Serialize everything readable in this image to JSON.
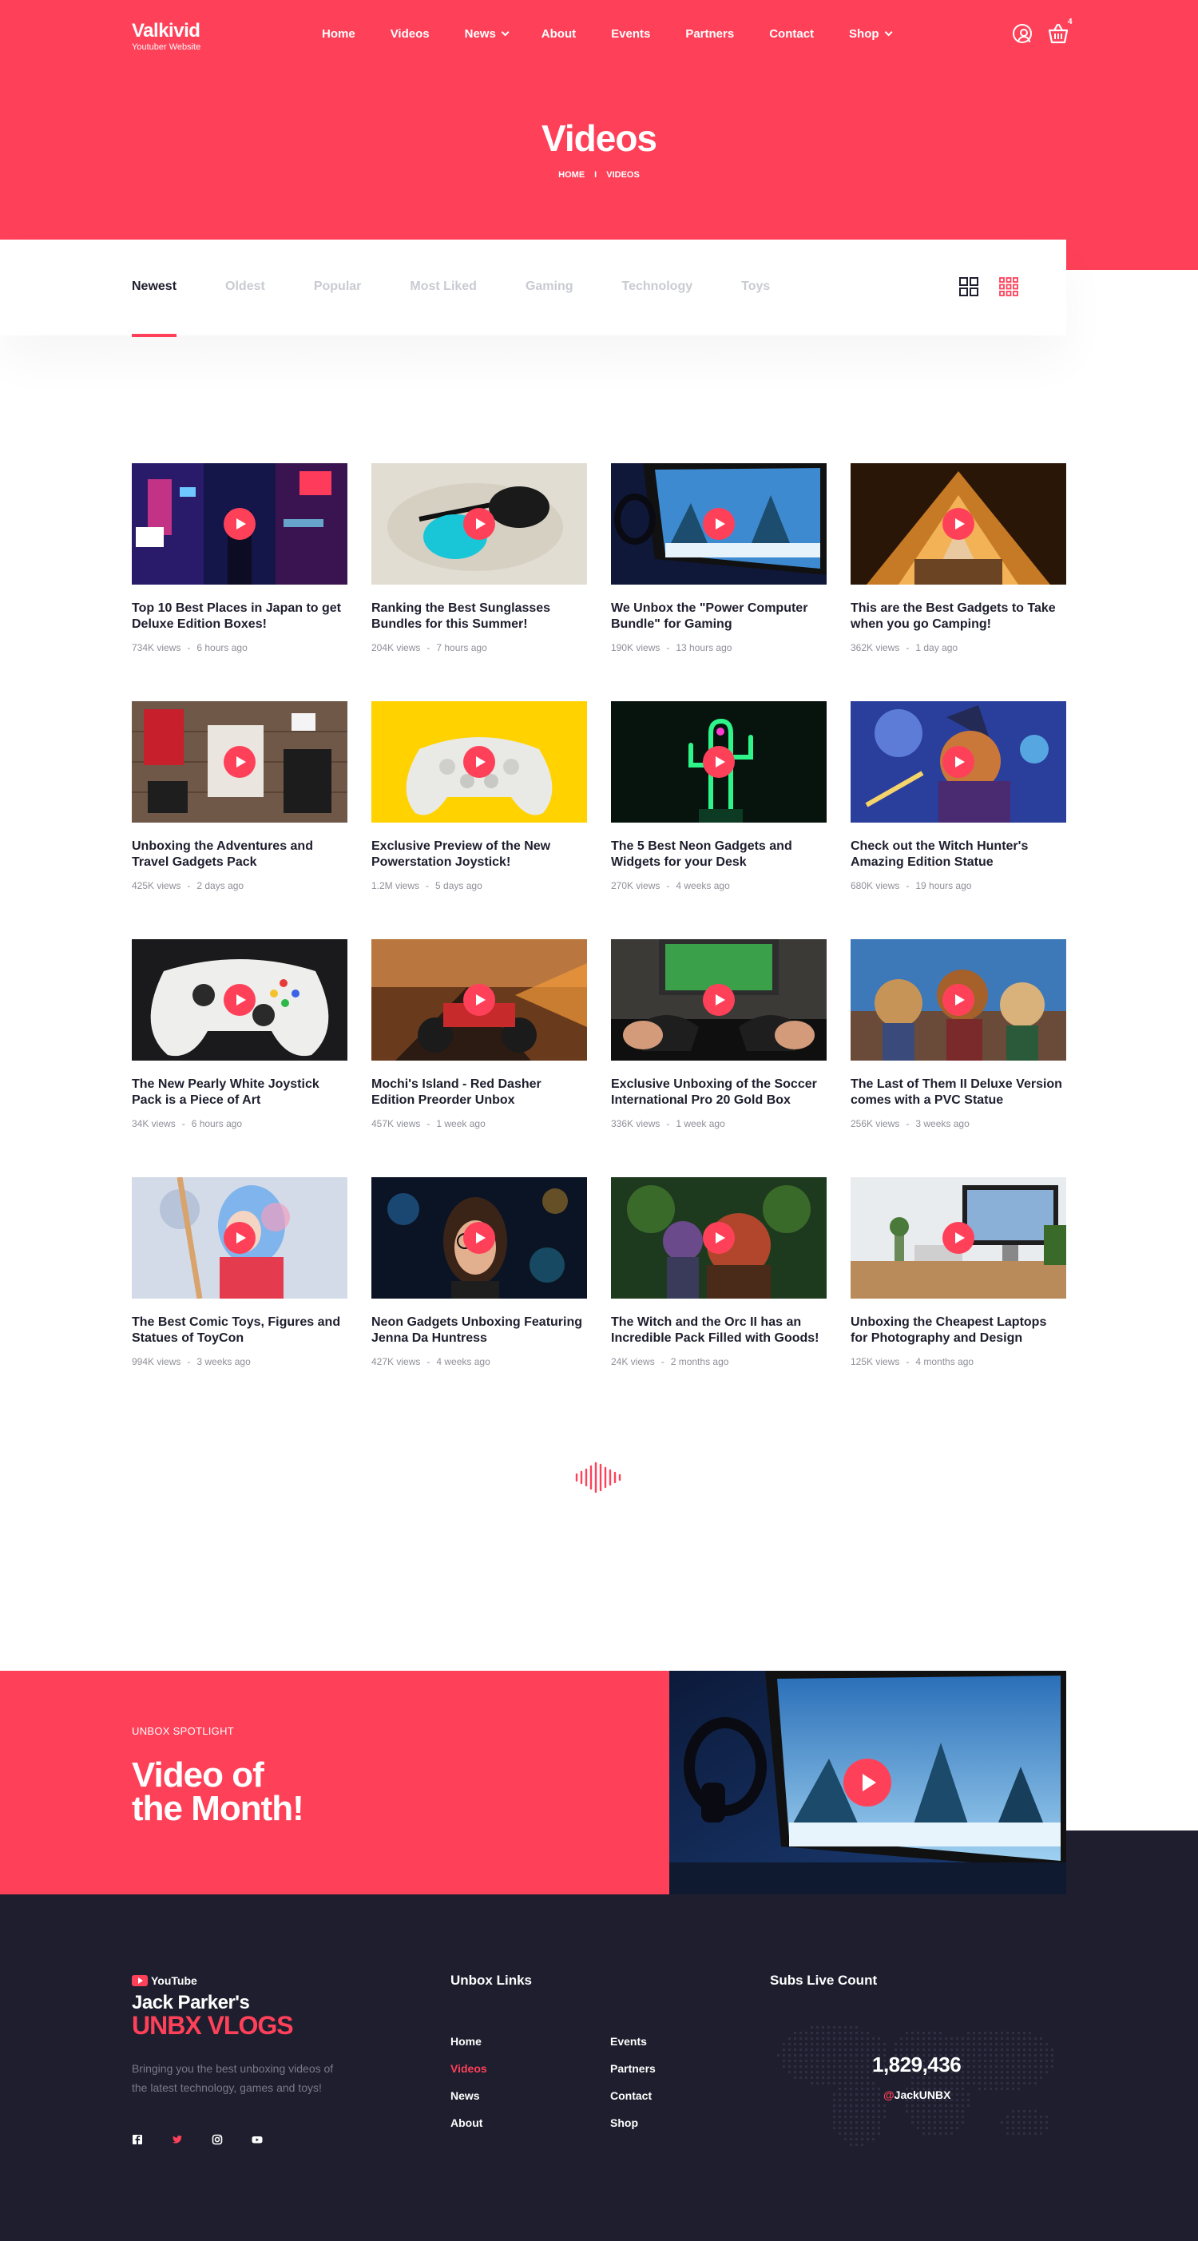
{
  "header": {
    "logo": "Valkivid",
    "tagline": "Youtuber Website",
    "nav": [
      {
        "label": "Home",
        "dropdown": false
      },
      {
        "label": "Videos",
        "dropdown": false
      },
      {
        "label": "News",
        "dropdown": true
      },
      {
        "label": "About",
        "dropdown": false
      },
      {
        "label": "Events",
        "dropdown": false
      },
      {
        "label": "Partners",
        "dropdown": false
      },
      {
        "label": "Contact",
        "dropdown": false
      },
      {
        "label": "Shop",
        "dropdown": true
      }
    ],
    "cart_count": "4",
    "icons": [
      "user-icon",
      "cart-icon"
    ]
  },
  "hero": {
    "title": "Videos",
    "breadcrumb": [
      "HOME",
      "VIDEOS"
    ]
  },
  "filters": {
    "tabs": [
      "Newest",
      "Oldest",
      "Popular",
      "Most Liked",
      "Gaming",
      "Technology",
      "Toys"
    ],
    "active": "Newest",
    "views": [
      "grid-view-icon",
      "list-view-icon"
    ]
  },
  "videos": [
    {
      "title": "Top 10 Best Places in Japan to get Deluxe Edition Boxes!",
      "views": "734K views",
      "time": "6 hours ago"
    },
    {
      "title": "Ranking the Best Sunglasses Bundles for this Summer!",
      "views": "204K views",
      "time": "7 hours ago"
    },
    {
      "title": "We Unbox the \"Power Computer Bundle\" for Gaming",
      "views": "190K views",
      "time": "13 hours ago"
    },
    {
      "title": "This are the Best Gadgets to Take when you go Camping!",
      "views": "362K views",
      "time": "1 day ago"
    },
    {
      "title": "Unboxing the Adventures and Travel Gadgets Pack",
      "views": "425K views",
      "time": "2 days ago"
    },
    {
      "title": "Exclusive Preview of the New Powerstation Joystick!",
      "views": "1.2M views",
      "time": "5 days ago"
    },
    {
      "title": "The 5 Best Neon Gadgets and Widgets for your Desk",
      "views": "270K views",
      "time": "4 weeks ago"
    },
    {
      "title": "Check out the Witch Hunter's Amazing Edition Statue",
      "views": "680K views",
      "time": "19 hours ago"
    },
    {
      "title": "The New Pearly White Joystick Pack is a Piece of Art",
      "views": "34K views",
      "time": "6 hours ago"
    },
    {
      "title": "Mochi's Island - Red Dasher Edition Preorder Unbox",
      "views": "457K views",
      "time": "1 week ago"
    },
    {
      "title": "Exclusive Unboxing of the Soccer International Pro 20 Gold Box",
      "views": "336K views",
      "time": "1 week ago"
    },
    {
      "title": "The Last of Them II Deluxe Version comes with a PVC Statue",
      "views": "256K views",
      "time": "3 weeks ago"
    },
    {
      "title": "The Best Comic Toys, Figures and Statues of ToyCon",
      "views": "994K views",
      "time": "3 weeks ago"
    },
    {
      "title": "Neon Gadgets Unboxing Featuring Jenna Da Huntress",
      "views": "427K views",
      "time": "4 weeks ago"
    },
    {
      "title": "The Witch and the Orc II has an Incredible Pack Filled with Goods!",
      "views": "24K views",
      "time": "2 months ago"
    },
    {
      "title": "Unboxing the Cheapest Laptops for Photography and Design",
      "views": "125K views",
      "time": "4 months ago"
    }
  ],
  "spotlight": {
    "kicker": "UNBOX SPOTLIGHT",
    "title_line1": "Video of",
    "title_line2": "the Month!"
  },
  "footer": {
    "yt_label": "YouTube",
    "brand_line1": "Jack Parker's",
    "brand_line2": "UNBX VLOGS",
    "description": "Bringing you the best unboxing videos of the latest technology, games and toys!",
    "socials": [
      "facebook-icon",
      "twitter-icon",
      "instagram-icon",
      "youtube-icon"
    ],
    "links_title": "Unbox Links",
    "links_col1": [
      "Home",
      "Videos",
      "News",
      "About"
    ],
    "links_col2": [
      "Events",
      "Partners",
      "Contact",
      "Shop"
    ],
    "active_link": "Videos",
    "subs_title": "Subs Live Count",
    "subs_count": "1,829,436",
    "subs_at": "@",
    "subs_handle": "JackUNBX"
  },
  "colors": {
    "accent": "#fe4159",
    "dark": "#1e1e2e",
    "muted": "#c9cbd2"
  }
}
